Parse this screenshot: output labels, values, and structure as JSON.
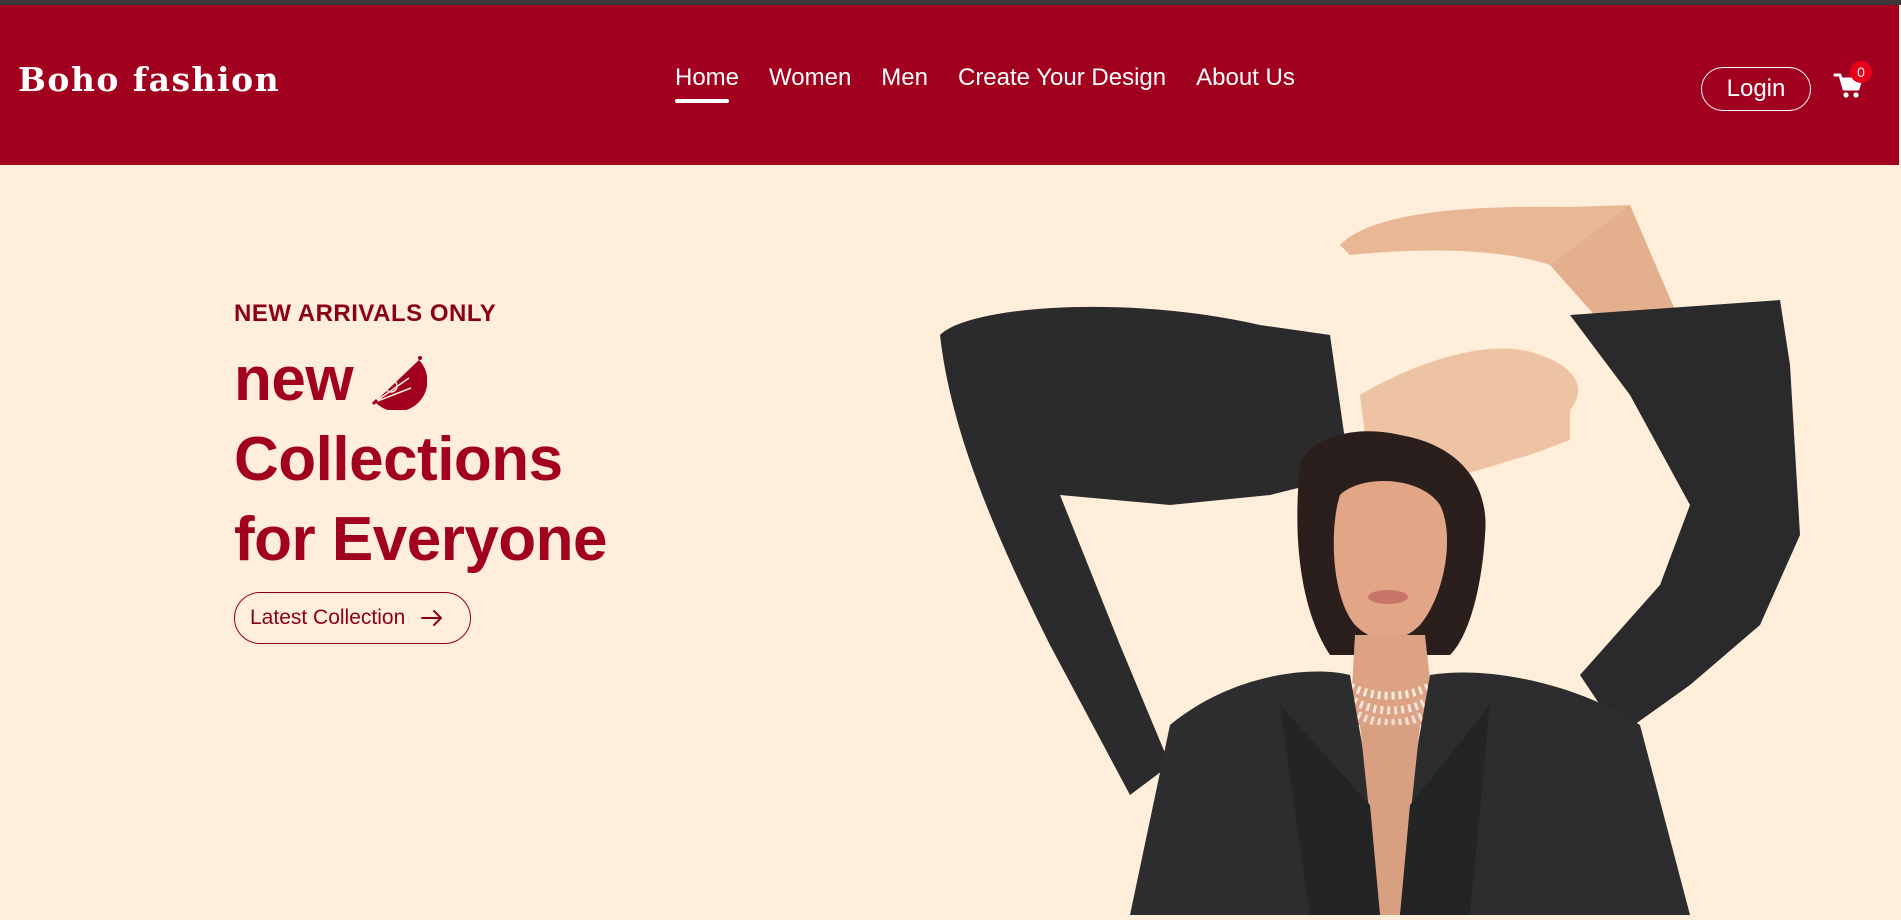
{
  "header": {
    "logo": "Boho fashion",
    "nav": [
      {
        "label": "Home",
        "active": true
      },
      {
        "label": "Women",
        "active": false
      },
      {
        "label": "Men",
        "active": false
      },
      {
        "label": "Create Your Design",
        "active": false
      },
      {
        "label": "About Us",
        "active": false
      }
    ],
    "login_label": "Login",
    "cart_count": "0",
    "cart_icon": "shopping-cart-icon"
  },
  "hero": {
    "eyebrow": "NEW ARRIVALS ONLY",
    "headline_word": "new",
    "headline_line2": "Collections",
    "headline_line3": "for Everyone",
    "headline_icon": "hand-fan-icon",
    "cta_label": "Latest Collection",
    "cta_icon": "arrow-right-icon",
    "image": "woman-in-black-blazer-photo"
  },
  "colors": {
    "brand": "#A1001F",
    "background": "#FFEEDA",
    "badge": "#E8001C"
  }
}
